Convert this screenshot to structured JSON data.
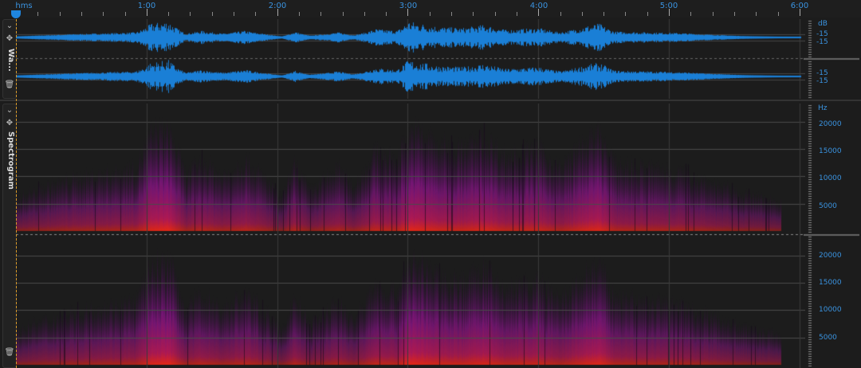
{
  "ruler": {
    "unit_label": "hms",
    "ticks": [
      {
        "label": "1:00",
        "seconds": 60
      },
      {
        "label": "2:00",
        "seconds": 120
      },
      {
        "label": "3:00",
        "seconds": 180
      },
      {
        "label": "4:00",
        "seconds": 240
      },
      {
        "label": "5:00",
        "seconds": 300
      },
      {
        "label": "6:00",
        "seconds": 360
      }
    ]
  },
  "waveform_track": {
    "name": "Wa...",
    "unit": "dB",
    "channel_labels": [
      [
        "-15",
        "-15"
      ],
      [
        "-15",
        "-15"
      ]
    ]
  },
  "spectrogram_track": {
    "name": "Spectrogram",
    "unit": "Hz",
    "freq_labels": [
      "20000",
      "15000",
      "10000",
      "5000"
    ]
  },
  "colors": {
    "accent": "#1f86e0",
    "wave": "#1a7fd6",
    "cursor": "#d89a2a"
  }
}
